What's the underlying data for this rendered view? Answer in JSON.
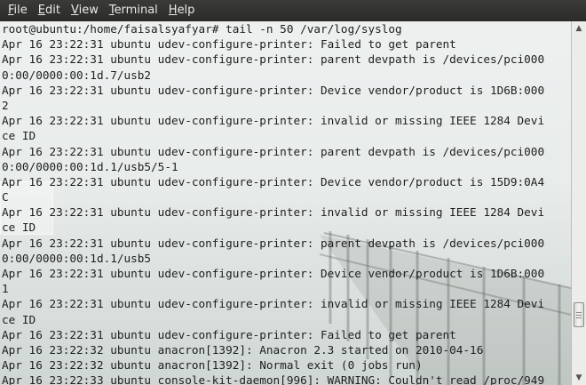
{
  "menu": {
    "file": "File",
    "edit": "Edit",
    "view": "View",
    "terminal": "Terminal",
    "help": "Help"
  },
  "terminal": {
    "lines": [
      "root@ubuntu:/home/faisalsyafyar# tail -n 50 /var/log/syslog",
      "Apr 16 23:22:31 ubuntu udev-configure-printer: Failed to get parent",
      "Apr 16 23:22:31 ubuntu udev-configure-printer: parent devpath is /devices/pci000",
      "0:00/0000:00:1d.7/usb2",
      "Apr 16 23:22:31 ubuntu udev-configure-printer: Device vendor/product is 1D6B:000",
      "2",
      "Apr 16 23:22:31 ubuntu udev-configure-printer: invalid or missing IEEE 1284 Devi",
      "ce ID",
      "Apr 16 23:22:31 ubuntu udev-configure-printer: parent devpath is /devices/pci000",
      "0:00/0000:00:1d.1/usb5/5-1",
      "Apr 16 23:22:31 ubuntu udev-configure-printer: Device vendor/product is 15D9:0A4",
      "C",
      "Apr 16 23:22:31 ubuntu udev-configure-printer: invalid or missing IEEE 1284 Devi",
      "ce ID",
      "Apr 16 23:22:31 ubuntu udev-configure-printer: parent devpath is /devices/pci000",
      "0:00/0000:00:1d.1/usb5",
      "Apr 16 23:22:31 ubuntu udev-configure-printer: Device vendor/product is 1D6B:000",
      "1",
      "Apr 16 23:22:31 ubuntu udev-configure-printer: invalid or missing IEEE 1284 Devi",
      "ce ID",
      "Apr 16 23:22:31 ubuntu udev-configure-printer: Failed to get parent",
      "Apr 16 23:22:32 ubuntu anacron[1392]: Anacron 2.3 started on 2010-04-16",
      "Apr 16 23:22:32 ubuntu anacron[1392]: Normal exit (0 jobs run)",
      "Apr 16 23:22:33 ubuntu console-kit-daemon[996]: WARNING: Couldn't read /proc/949"
    ]
  },
  "scrollbar": {
    "position": 0.86,
    "up_icon": "arrow-up-icon",
    "down_icon": "arrow-down-icon"
  }
}
